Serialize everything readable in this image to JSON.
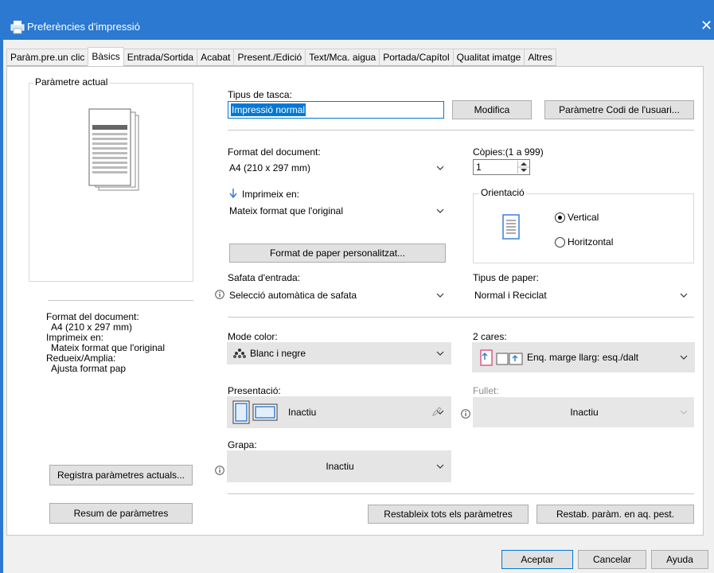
{
  "window": {
    "title": "Preferències d'impressió",
    "close_glyph": "✕"
  },
  "tabs": [
    {
      "label": "Paràm.pre.un clic"
    },
    {
      "label": "Bàsics"
    },
    {
      "label": "Entrada/Sortida"
    },
    {
      "label": "Acabat"
    },
    {
      "label": "Present./Edició"
    },
    {
      "label": "Text/Mca. aigua"
    },
    {
      "label": "Portada/Capítol"
    },
    {
      "label": "Qualitat imatge"
    },
    {
      "label": "Altres"
    }
  ],
  "left": {
    "current_label": "Paràmetre actual",
    "summary": [
      "Format del document:",
      "  A4 (210 x 297 mm)",
      "Imprimeix en:",
      "  Mateix format que l'original",
      "Redueix/Amplia:",
      "  Ajusta format pap"
    ],
    "register_button": "Registra paràmetres actuals...",
    "summary_button": "Resum de paràmetres"
  },
  "job": {
    "label": "Tipus de tasca:",
    "value": "Impressió normal",
    "modify_button": "Modifica",
    "user_code_button": "Paràmetre Codi de l'usuari..."
  },
  "document": {
    "format_label": "Format del document:",
    "format_value": "A4 (210 x 297 mm)",
    "print_on_label": "Imprimeix en:",
    "print_on_value": "Mateix format que l'original",
    "custom_paper_button": "Format de paper personalitzat..."
  },
  "copies": {
    "label": "Còpies:(1 a 999)",
    "value": "1"
  },
  "orientation": {
    "label": "Orientació",
    "vertical": "Vertical",
    "horizontal": "Horitzontal",
    "selected": "Vertical"
  },
  "tray": {
    "label": "Safata d'entrada:",
    "value": "Selecció automàtica de safata"
  },
  "paper_type": {
    "label": "Tipus de paper:",
    "value": "Normal i Reciclat"
  },
  "color": {
    "label": "Mode color:",
    "value": "Blanc i negre"
  },
  "duplex": {
    "label": "2 cares:",
    "value": "Enq. marge llarg: esq./dalt"
  },
  "layout": {
    "label": "Presentació:",
    "value": "Inactiu"
  },
  "booklet": {
    "label": "Fullet:",
    "value": "Inactiu"
  },
  "staple": {
    "label": "Grapa:",
    "value": "Inactiu"
  },
  "bottom": {
    "reset_all_button": "Restableix tots els paràmetres",
    "reset_tab_button": "Restab. paràm. en aq. pest.",
    "ok_button": "Aceptar",
    "cancel_button": "Cancelar",
    "help_button": "Ayuda"
  },
  "colors": {
    "titlebar": "#2b79d0",
    "selection": "#0078d7",
    "dialog_bg": "#f0f0f0"
  }
}
